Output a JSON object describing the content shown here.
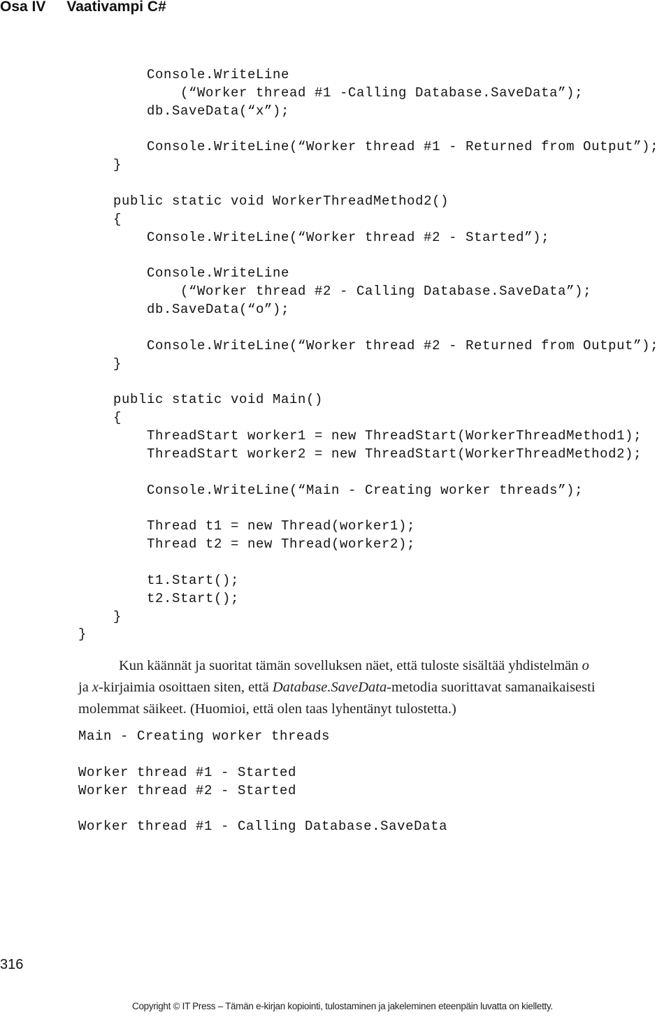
{
  "header": {
    "part": "Osa IV",
    "title": "Vaativampi C#"
  },
  "code_lines": [
    {
      "indent": 2,
      "text": "Console.WriteLine"
    },
    {
      "indent": 3,
      "text": "(“Worker thread #1 -Calling Database.SaveData”);"
    },
    {
      "indent": 2,
      "text": "db.SaveData(“x”);"
    },
    {
      "indent": 2,
      "text": ""
    },
    {
      "indent": 2,
      "text": "Console.WriteLine(“Worker thread #1 - Returned from Output”);"
    },
    {
      "indent": 1,
      "text": "}"
    },
    {
      "indent": 1,
      "text": ""
    },
    {
      "indent": 1,
      "text": "public static void WorkerThreadMethod2()"
    },
    {
      "indent": 1,
      "text": "{"
    },
    {
      "indent": 2,
      "text": "Console.WriteLine(“Worker thread #2 - Started”);"
    },
    {
      "indent": 2,
      "text": ""
    },
    {
      "indent": 2,
      "text": "Console.WriteLine"
    },
    {
      "indent": 3,
      "text": "(“Worker thread #2 - Calling Database.SaveData”);"
    },
    {
      "indent": 2,
      "text": "db.SaveData(“o”);"
    },
    {
      "indent": 2,
      "text": ""
    },
    {
      "indent": 2,
      "text": "Console.WriteLine(“Worker thread #2 - Returned from Output”);"
    },
    {
      "indent": 1,
      "text": "}"
    },
    {
      "indent": 1,
      "text": ""
    },
    {
      "indent": 1,
      "text": "public static void Main()"
    },
    {
      "indent": 1,
      "text": "{"
    },
    {
      "indent": 2,
      "text": "ThreadStart worker1 = new ThreadStart(WorkerThreadMethod1);"
    },
    {
      "indent": 2,
      "text": "ThreadStart worker2 = new ThreadStart(WorkerThreadMethod2);"
    },
    {
      "indent": 2,
      "text": ""
    },
    {
      "indent": 2,
      "text": "Console.WriteLine(“Main - Creating worker threads”);"
    },
    {
      "indent": 2,
      "text": ""
    },
    {
      "indent": 2,
      "text": "Thread t1 = new Thread(worker1);"
    },
    {
      "indent": 2,
      "text": "Thread t2 = new Thread(worker2);"
    },
    {
      "indent": 2,
      "text": ""
    },
    {
      "indent": 2,
      "text": "t1.Start();"
    },
    {
      "indent": 2,
      "text": "t2.Start();"
    },
    {
      "indent": 1,
      "text": "}"
    },
    {
      "indent": 0,
      "text": "}"
    }
  ],
  "paragraph": {
    "line1": "Kun käännät ja suoritat tämän sovelluksen näet, että tuloste sisältää yhdistelmän ",
    "line1_italic": "o",
    "line2_a": "ja ",
    "line2_italic_x": "x",
    "line2_b": "-kirjaimia osoittaen siten, että ",
    "line2_italic_method": "Database.SaveData",
    "line2_c": "-metodia suorittavat samanaikaisesti",
    "line3": "molemmat säikeet. (Huomioi, että olen taas lyhentänyt tulostetta.)"
  },
  "output_lines": [
    "Main - Creating worker threads",
    "",
    "Worker thread #1 - Started",
    "Worker thread #2 - Started",
    "",
    "Worker thread #1 - Calling Database.SaveData"
  ],
  "page_number": "316",
  "footer": "Copyright © IT Press – Tämän e-kirjan kopiointi, tulostaminen ja jakeleminen eteenpäin luvatta on kielletty."
}
